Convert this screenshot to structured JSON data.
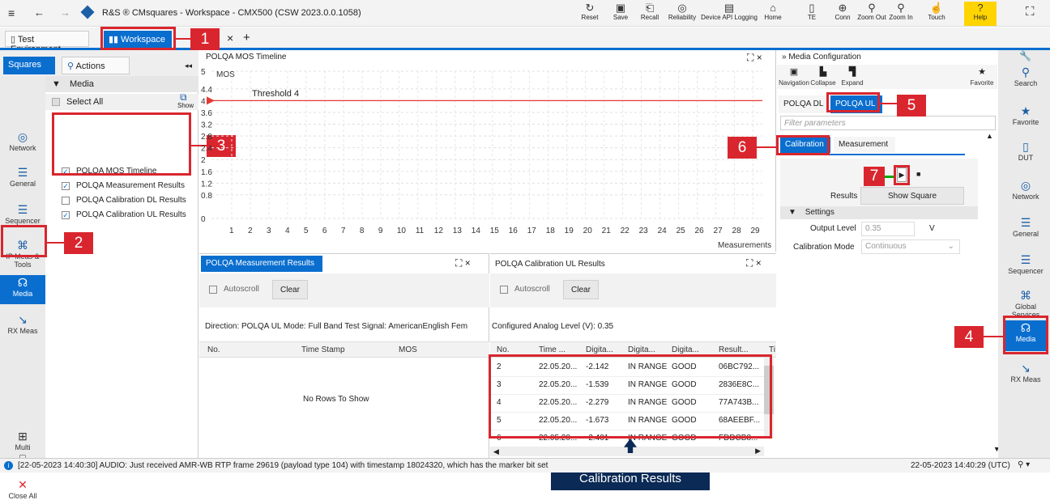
{
  "titlebar": {
    "menu_icon": "≡",
    "back": "←",
    "forward": "→",
    "title": "R&S ® CMsquares - Workspace - CMX500 (CSW 2023.0.0.1058)",
    "buttons": [
      {
        "label": "Reset",
        "icon": "↻"
      },
      {
        "label": "Save",
        "icon": "▣"
      },
      {
        "label": "Recall",
        "icon": "⎗"
      },
      {
        "label": "Reliability",
        "icon": "◎"
      },
      {
        "label": "Device API Logging",
        "icon": "▤"
      },
      {
        "label": "Home",
        "icon": "⌂"
      },
      {
        "label": "TE",
        "icon": "▯"
      },
      {
        "label": "Conn",
        "icon": "⊕"
      },
      {
        "label": "Zoom Out",
        "icon": "⚲"
      },
      {
        "label": "Zoom In",
        "icon": "⚲"
      },
      {
        "label": "Touch",
        "icon": "☝"
      },
      {
        "label": "Help",
        "icon": "?"
      }
    ],
    "expand_icon": "⛶"
  },
  "tabs": {
    "test_env": "Test Environment",
    "workspace": "Workspace",
    "close": "×",
    "add": "+"
  },
  "callouts": {
    "c1": "1",
    "c2": "2",
    "c3": "3",
    "c4": "4",
    "c5": "5",
    "c6": "6",
    "c7": "7"
  },
  "left": {
    "tab_squares": "Squares",
    "tab_actions": "Actions",
    "collapse": "◂◂",
    "side": [
      {
        "label": "Network",
        "icon": "◎"
      },
      {
        "label": "General",
        "icon": "☰"
      },
      {
        "label": "Sequencer",
        "icon": "☰"
      },
      {
        "label": "IP Meas & Tools",
        "icon": "⌘"
      },
      {
        "label": "Media",
        "icon": "☊"
      },
      {
        "label": "RX Meas",
        "icon": "↘"
      }
    ],
    "bottom": [
      {
        "label": "Multi",
        "icon": "⊞"
      },
      {
        "label": "Tab",
        "icon": "⎕"
      },
      {
        "label": "Close All",
        "icon": "✕"
      }
    ],
    "group": "Media",
    "select_all": "Select All",
    "show": "Show",
    "items": [
      {
        "label": "POLQA MOS Timeline",
        "checked": "✓"
      },
      {
        "label": "POLQA Measurement Results",
        "checked": "✓"
      },
      {
        "label": "POLQA Calibration DL Results",
        "checked": ""
      },
      {
        "label": "POLQA Calibration UL Results",
        "checked": "✓"
      }
    ]
  },
  "chart": {
    "panel_title": "POLQA MOS Timeline",
    "ylabel": "MOS",
    "xlabel": "Measurements",
    "threshold_label": "Threshold 4",
    "controls": "⛶ ×"
  },
  "chart_data": {
    "type": "line",
    "title": "POLQA MOS Timeline",
    "ylabel": "MOS",
    "xlabel": "Measurements",
    "y_ticks": [
      "5",
      "4.4",
      "4",
      "3.6",
      "3.2",
      "2.8",
      "2.4",
      "2",
      "1.6",
      "1.2",
      "0.8",
      "0"
    ],
    "x_ticks": [
      "1",
      "2",
      "3",
      "4",
      "5",
      "6",
      "7",
      "8",
      "9",
      "10",
      "11",
      "12",
      "13",
      "14",
      "15",
      "16",
      "17",
      "18",
      "19",
      "20",
      "21",
      "22",
      "23",
      "24",
      "25",
      "26",
      "27",
      "28",
      "29"
    ],
    "ylim": [
      0,
      5
    ],
    "threshold": 4,
    "series": []
  },
  "meas": {
    "title": "POLQA Measurement Results",
    "autoscroll": "Autoscroll",
    "clear": "Clear",
    "info": "Direction:  POLQA UL  Mode:  Full Band  Test Signal:  AmericanEnglish Fem",
    "cols": [
      "No.",
      "Time Stamp",
      "MOS"
    ],
    "empty": "No Rows To Show",
    "controls": "⛶ ×"
  },
  "cal": {
    "title": "POLQA Calibration UL Results",
    "autoscroll": "Autoscroll",
    "clear": "Clear",
    "info": "Configured Analog Level (V):  0.35",
    "controls": "⛶ ×",
    "cols": [
      "No.",
      "Time ...",
      "Digita...",
      "Digita...",
      "Digita...",
      "Result...",
      "Ti"
    ],
    "rows": [
      [
        "2",
        "22.05.20...",
        "-2.142",
        "IN RANGE",
        "GOOD",
        "06BC792..."
      ],
      [
        "3",
        "22.05.20...",
        "-1.539",
        "IN RANGE",
        "GOOD",
        "2836E8C..."
      ],
      [
        "4",
        "22.05.20...",
        "-2.279",
        "IN RANGE",
        "GOOD",
        "77A743B..."
      ],
      [
        "5",
        "22.05.20...",
        "-1.673",
        "IN RANGE",
        "GOOD",
        "68AEEBF..."
      ],
      [
        "6",
        "22.05.20...",
        "-2.401",
        "IN RANGE",
        "GOOD",
        "FDDCB8..."
      ]
    ]
  },
  "media_cfg": {
    "title": "Media Configuration",
    "navigation": "Navigation",
    "collapse": "Collapse",
    "expand": "Expand",
    "favorite": "Favorite",
    "tab_dl": "POLQA DL",
    "tab_ul": "POLQA UL",
    "filter_placeholder": "Filter parameters",
    "sub_cal": "Calibration",
    "sub_meas": "Measurement",
    "results_label": "Results",
    "show_square": "Show Square",
    "settings": "Settings",
    "output_level_label": "Output Level",
    "output_level": "0.35",
    "unit": "V",
    "cal_mode_label": "Calibration Mode",
    "cal_mode": "Continuous"
  },
  "right_side": [
    {
      "label": "Search",
      "icon": "⚲"
    },
    {
      "label": "Favorite",
      "icon": "★"
    },
    {
      "label": "DUT",
      "icon": "▯"
    },
    {
      "label": "Network",
      "icon": "◎"
    },
    {
      "label": "General",
      "icon": "☰"
    },
    {
      "label": "Sequencer",
      "icon": "☰"
    },
    {
      "label": "Global Services",
      "icon": "⌘"
    },
    {
      "label": "Media",
      "icon": "☊"
    },
    {
      "label": "RX Meas",
      "icon": "↘"
    }
  ],
  "status": {
    "message": "[22-05-2023 14:40:30] AUDIO: Just received AMR-WB RTP frame 29619 (payload type 104) with timestamp 18024320, which has the marker bit set",
    "time": "22-05-2023 14:40:29 (UTC)"
  },
  "annotation": {
    "cal_results": "Calibration Results"
  }
}
